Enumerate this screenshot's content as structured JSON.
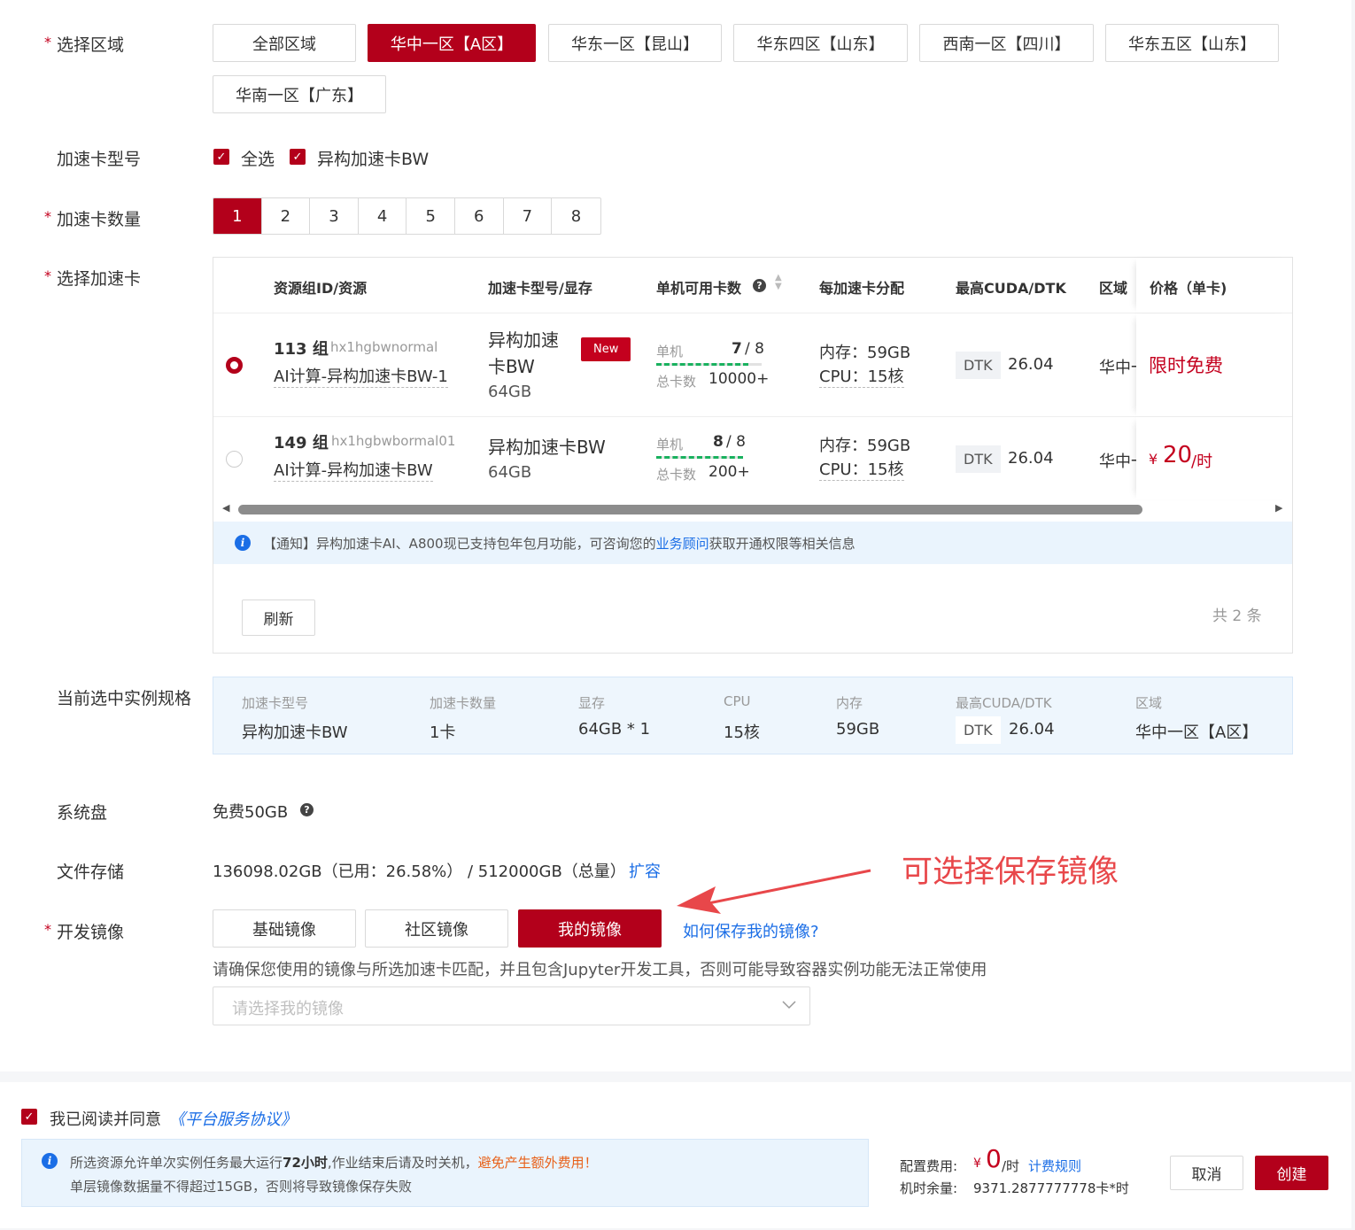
{
  "region": {
    "label": "选择区域",
    "options": [
      "全部区域",
      "华中一区【A区】",
      "华东一区【昆山】",
      "华东四区【山东】",
      "西南一区【四川】",
      "华东五区【山东】",
      "华南一区【广东】"
    ],
    "selected": "华中一区【A区】"
  },
  "card_type": {
    "label": "加速卡型号",
    "options": [
      "全选",
      "异构加速卡BW"
    ]
  },
  "card_count": {
    "label": "加速卡数量",
    "options": [
      "1",
      "2",
      "3",
      "4",
      "5",
      "6",
      "7",
      "8"
    ],
    "selected": "1"
  },
  "select_card": {
    "label": "选择加速卡",
    "headers": [
      "资源组ID/资源",
      "加速卡型号/显存",
      "单机可用卡数",
      "每加速卡分配",
      "最高CUDA/DTK",
      "区域",
      "价格（单卡)"
    ],
    "rows": [
      {
        "group_id": "113 组",
        "group_code": "hx1hgbwnormal",
        "resource": "AI计算-异构加速卡BW-1",
        "model_line1": "异构加速",
        "model_line2": "卡BW",
        "memory": "64GB",
        "badge": "New",
        "single_label": "单机",
        "single_avail": "7",
        "single_total": "/ 8",
        "total_label": "总卡数",
        "total_value": "10000+",
        "alloc_mem": "内存：59GB",
        "alloc_cpu": "CPU：15核",
        "dtk": "DTK",
        "dtk_version": "26.04",
        "region": "华中一",
        "price": "限时免费",
        "selected": true,
        "availability_fraction": 0.875
      },
      {
        "group_id": "149 组",
        "group_code": "hx1hgbwbormal01",
        "resource": "AI计算-异构加速卡BW",
        "model_line1": "异构加速卡BW",
        "model_line2": "",
        "memory": "64GB",
        "badge": "",
        "single_label": "单机",
        "single_avail": "8",
        "single_total": "/ 8",
        "total_label": "总卡数",
        "total_value": "200+",
        "alloc_mem": "内存：59GB",
        "alloc_cpu": "CPU：15核",
        "dtk": "DTK",
        "dtk_version": "26.04",
        "region": "华中一",
        "price_currency": "¥",
        "price_value": "20",
        "price_unit": "/时",
        "selected": false,
        "availability_fraction": 1.0
      }
    ],
    "notice_prefix": "【通知】异构加速卡AI、A800现已支持包年包月功能，可咨询您的",
    "notice_link": "业务顾问",
    "notice_suffix": "获取开通权限等相关信息",
    "refresh": "刷新",
    "total": "共 2 条",
    "scroll_fraction": 0.88
  },
  "spec": {
    "label": "当前选中实例规格",
    "items": [
      {
        "key": "加速卡型号",
        "value": "异构加速卡BW"
      },
      {
        "key": "加速卡数量",
        "value": "1卡"
      },
      {
        "key": "显存",
        "value": "64GB * 1"
      },
      {
        "key": "CPU",
        "value": "15核"
      },
      {
        "key": "内存",
        "value": "59GB"
      },
      {
        "key": "最高CUDA/DTK",
        "value": "26.04",
        "tag": "DTK"
      },
      {
        "key": "区域",
        "value": "华中一区【A区】"
      }
    ]
  },
  "system_disk": {
    "label": "系统盘",
    "value": "免费50GB"
  },
  "file_storage": {
    "label": "文件存储",
    "value": "136098.02GB（已用：26.58%） / 512000GB（总量）",
    "expand": "扩容"
  },
  "annotation": "可选择保存镜像",
  "image": {
    "label": "开发镜像",
    "tabs": [
      "基础镜像",
      "社区镜像",
      "我的镜像"
    ],
    "selected": "我的镜像",
    "help_link": "如何保存我的镜像?",
    "hint": "请确保您使用的镜像与所选加速卡匹配，并且包含Jupyter开发工具，否则可能导致容器实例功能无法正常使用",
    "placeholder": "请选择我的镜像"
  },
  "footer": {
    "agree_text": "我已阅读并同意",
    "agree_link": "《平台服务协议》",
    "tip_line1_a": "所选资源允许单次实例任务最大运行",
    "tip_line1_bold": "72小时",
    "tip_line1_b": ",作业结束后请及时关机，",
    "tip_line1_warn": "避免产生额外费用！",
    "tip_line2": "单层镜像数据量不得超过15GB，否则将导致镜像保存失败",
    "cost_label": "配置费用:",
    "cost_currency": "¥",
    "cost_value": "0",
    "cost_unit": "/时",
    "billing_rule": "计费规则",
    "balance_label": "机时余量:",
    "balance_value": "9371.2877777778卡*时",
    "cancel": "取消",
    "create": "创建"
  },
  "colors": {
    "brand": "#b3001b",
    "link": "#1b6ee6",
    "annotation": "#e8474a"
  }
}
